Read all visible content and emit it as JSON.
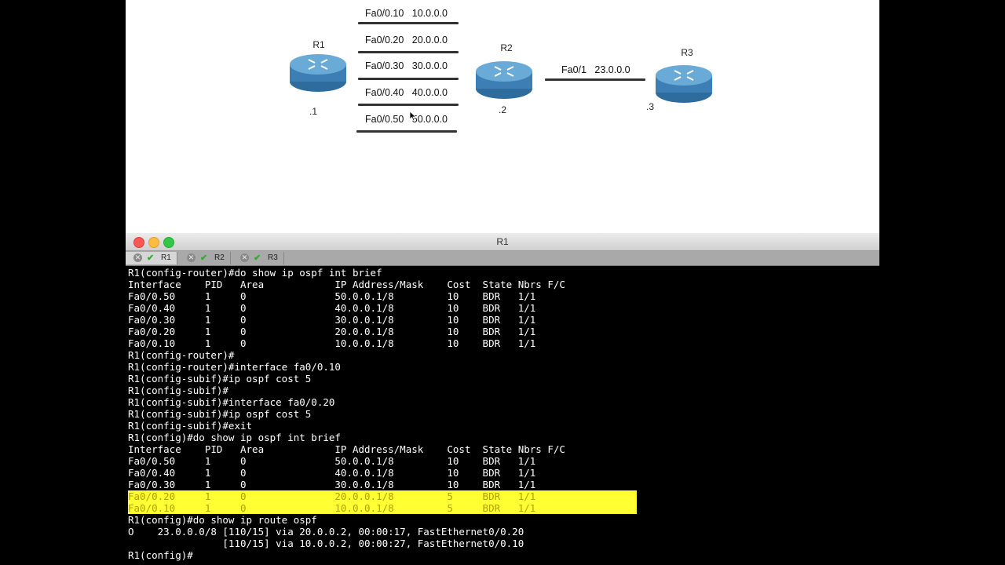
{
  "diagram": {
    "routers": [
      {
        "name": "R1",
        "addr": ".1"
      },
      {
        "name": "R2",
        "addr": ".2"
      },
      {
        "name": "R3",
        "addr": ".3"
      }
    ],
    "subinterfaces": [
      {
        "if": "Fa0/0.10",
        "net": "10.0.0.0"
      },
      {
        "if": "Fa0/0.20",
        "net": "20.0.0.0"
      },
      {
        "if": "Fa0/0.30",
        "net": "30.0.0.0"
      },
      {
        "if": "Fa0/0.40",
        "net": "40.0.0.0"
      },
      {
        "if": "Fa0/0.50",
        "net": "50.0.0.0"
      }
    ],
    "r2r3_link": {
      "if": "Fa0/1",
      "net": "23.0.0.0"
    }
  },
  "window": {
    "title": "R1",
    "tabs": [
      {
        "label": "R1",
        "active": true
      },
      {
        "label": "R2",
        "active": false
      },
      {
        "label": "R3",
        "active": false
      }
    ]
  },
  "terminal": {
    "lines": [
      {
        "text": "R1(config-router)#do show ip ospf int brief",
        "hl": false
      },
      {
        "text": "Interface    PID   Area            IP Address/Mask    Cost  State Nbrs F/C",
        "hl": false
      },
      {
        "text": "Fa0/0.50     1     0               50.0.0.1/8         10    BDR   1/1",
        "hl": false
      },
      {
        "text": "Fa0/0.40     1     0               40.0.0.1/8         10    BDR   1/1",
        "hl": false
      },
      {
        "text": "Fa0/0.30     1     0               30.0.0.1/8         10    BDR   1/1",
        "hl": false
      },
      {
        "text": "Fa0/0.20     1     0               20.0.0.1/8         10    BDR   1/1",
        "hl": false
      },
      {
        "text": "Fa0/0.10     1     0               10.0.0.1/8         10    BDR   1/1",
        "hl": false
      },
      {
        "text": "R1(config-router)#",
        "hl": false
      },
      {
        "text": "R1(config-router)#interface fa0/0.10",
        "hl": false
      },
      {
        "text": "R1(config-subif)#ip ospf cost 5",
        "hl": false
      },
      {
        "text": "R1(config-subif)#",
        "hl": false
      },
      {
        "text": "R1(config-subif)#interface fa0/0.20",
        "hl": false
      },
      {
        "text": "R1(config-subif)#ip ospf cost 5",
        "hl": false
      },
      {
        "text": "R1(config-subif)#exit",
        "hl": false
      },
      {
        "text": "R1(config)#do show ip ospf int brief",
        "hl": false
      },
      {
        "text": "Interface    PID   Area            IP Address/Mask    Cost  State Nbrs F/C",
        "hl": false
      },
      {
        "text": "Fa0/0.50     1     0               50.0.0.1/8         10    BDR   1/1",
        "hl": false
      },
      {
        "text": "Fa0/0.40     1     0               40.0.0.1/8         10    BDR   1/1",
        "hl": false
      },
      {
        "text": "Fa0/0.30     1     0               30.0.0.1/8         10    BDR   1/1",
        "hl": false
      },
      {
        "text": "Fa0/0.20     1     0               20.0.0.1/8         5     BDR   1/1",
        "hl": true
      },
      {
        "text": "Fa0/0.10     1     0               10.0.0.1/8         5     BDR   1/1",
        "hl": true
      },
      {
        "text": "R1(config)#do show ip route ospf",
        "hl": false
      },
      {
        "text": "O    23.0.0.0/8 [110/15] via 20.0.0.2, 00:00:17, FastEthernet0/0.20",
        "hl": false
      },
      {
        "text": "                [110/15] via 10.0.0.2, 00:00:27, FastEthernet0/0.10",
        "hl": false
      },
      {
        "text": "R1(config)#",
        "hl": false
      }
    ]
  },
  "colors": {
    "router_top": "#6aaad6",
    "router_body": "#3d7fb4",
    "highlight": "#ffff33",
    "terminal_bg": "#000000",
    "terminal_fg": "#ffffff"
  }
}
